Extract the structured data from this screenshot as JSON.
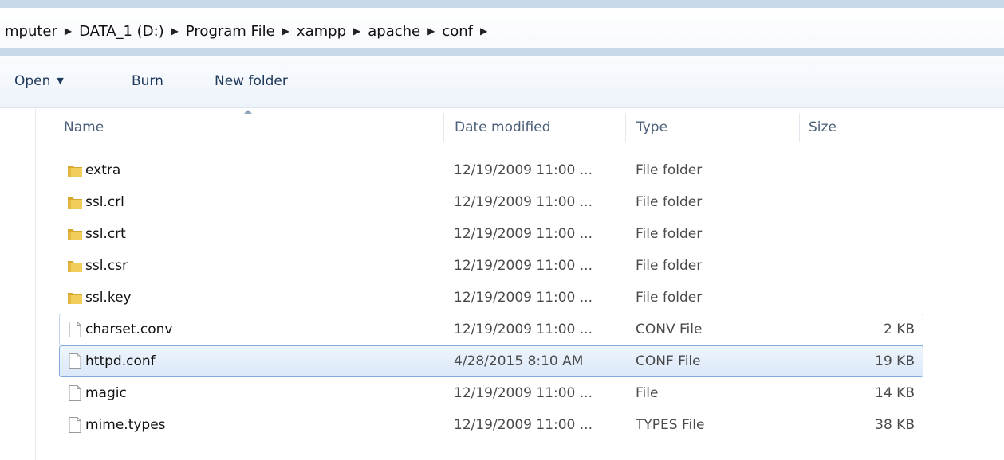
{
  "address": {
    "crumbs": [
      "mputer",
      "DATA_1 (D:)",
      "Program File",
      "xampp",
      "apache",
      "conf"
    ],
    "separator_icon": "breadcrumb-arrow-icon"
  },
  "toolbar": {
    "open_label": "Open",
    "burn_label": "Burn",
    "new_folder_label": "New folder"
  },
  "columns": {
    "name": "Name",
    "date": "Date modified",
    "type": "Type",
    "size": "Size",
    "sorted_by": "name"
  },
  "files": [
    {
      "name": "extra",
      "date": "12/19/2009 11:00 ...",
      "type": "File folder",
      "size": "",
      "icon": "folder-icon"
    },
    {
      "name": "ssl.crl",
      "date": "12/19/2009 11:00 ...",
      "type": "File folder",
      "size": "",
      "icon": "folder-icon"
    },
    {
      "name": "ssl.crt",
      "date": "12/19/2009 11:00 ...",
      "type": "File folder",
      "size": "",
      "icon": "folder-icon"
    },
    {
      "name": "ssl.csr",
      "date": "12/19/2009 11:00 ...",
      "type": "File folder",
      "size": "",
      "icon": "folder-icon"
    },
    {
      "name": "ssl.key",
      "date": "12/19/2009 11:00 ...",
      "type": "File folder",
      "size": "",
      "icon": "folder-icon"
    },
    {
      "name": "charset.conv",
      "date": "12/19/2009 11:00 ...",
      "type": "CONV File",
      "size": "2 KB",
      "icon": "file-icon"
    },
    {
      "name": "httpd.conf",
      "date": "4/28/2015 8:10 AM",
      "type": "CONF File",
      "size": "19 KB",
      "icon": "file-icon",
      "selected": true
    },
    {
      "name": "magic",
      "date": "12/19/2009 11:00 ...",
      "type": "File",
      "size": "14 KB",
      "icon": "file-icon"
    },
    {
      "name": "mime.types",
      "date": "12/19/2009 11:00 ...",
      "type": "TYPES File",
      "size": "38 KB",
      "icon": "file-icon"
    }
  ],
  "colors": {
    "selection_border": "#84acdd",
    "folder_yellow": "#e9c14f"
  }
}
